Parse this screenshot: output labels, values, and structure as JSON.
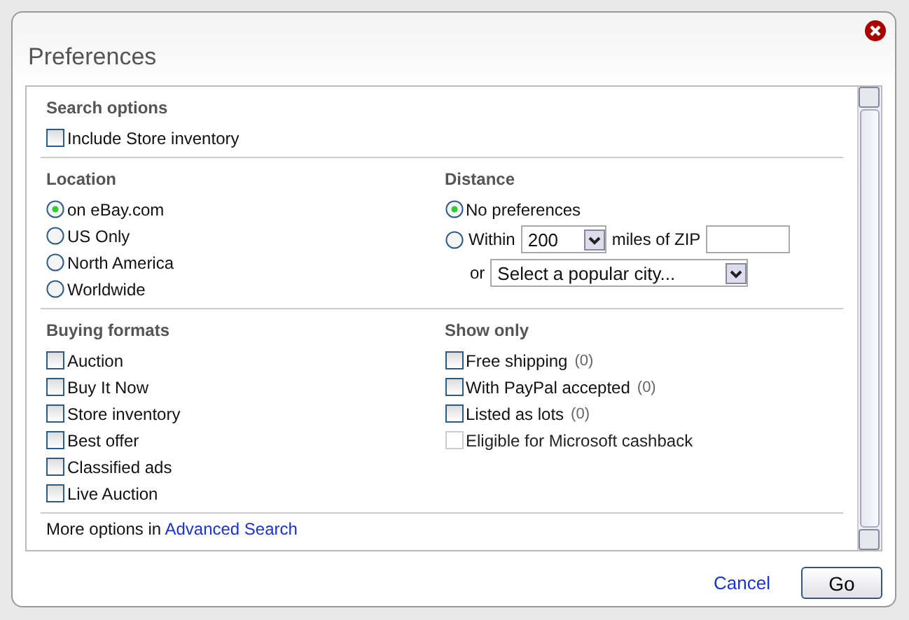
{
  "dialog": {
    "title": "Preferences"
  },
  "search_options": {
    "heading": "Search options",
    "options": [
      {
        "label": "Include Store inventory",
        "checked": false
      }
    ]
  },
  "location": {
    "heading": "Location",
    "options": [
      {
        "label": "on eBay.com",
        "selected": true
      },
      {
        "label": "US Only",
        "selected": false
      },
      {
        "label": "North America",
        "selected": false
      },
      {
        "label": "Worldwide",
        "selected": false
      }
    ]
  },
  "distance": {
    "heading": "Distance",
    "options": [
      {
        "kind": "plain",
        "label": "No preferences",
        "selected": true
      },
      {
        "kind": "within",
        "label": "Within",
        "selected": false
      }
    ],
    "radius": {
      "value": "200"
    },
    "zip_label": "miles of ZIP",
    "or_label": "or",
    "city": {
      "value": "Select a popular city..."
    }
  },
  "buying_formats": {
    "heading": "Buying formats",
    "options": [
      {
        "label": "Auction",
        "checked": false
      },
      {
        "label": "Buy It Now",
        "checked": false
      },
      {
        "label": "Store inventory",
        "checked": false
      },
      {
        "label": "Best offer",
        "checked": false
      },
      {
        "label": "Classified ads",
        "checked": false
      },
      {
        "label": "Live Auction",
        "checked": false
      }
    ]
  },
  "show_only": {
    "heading": "Show only",
    "options": [
      {
        "label": "Free shipping",
        "count": "(0)",
        "checked": false,
        "disabled": false
      },
      {
        "label": "With PayPal accepted",
        "count": "(0)",
        "checked": false,
        "disabled": false
      },
      {
        "label": "Listed as lots",
        "count": "(0)",
        "checked": false,
        "disabled": false
      },
      {
        "label": "Eligible for Microsoft cashback",
        "checked": false,
        "disabled": true
      }
    ]
  },
  "more_options": {
    "text": "More options in",
    "link": "Advanced Search"
  },
  "buttons": {
    "cancel": "Cancel",
    "go": "Go"
  }
}
